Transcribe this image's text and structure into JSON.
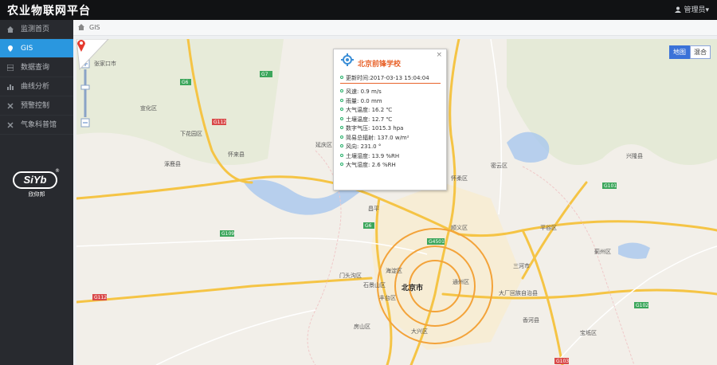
{
  "app": {
    "title": "农业物联网平台"
  },
  "user": {
    "label": "管理员▾"
  },
  "sidebar": {
    "items": [
      {
        "label": "监测首页",
        "active": false,
        "icon": "home-icon"
      },
      {
        "label": "GIS",
        "active": true,
        "icon": "location-icon"
      },
      {
        "label": "数据查询",
        "active": false,
        "icon": "table-icon"
      },
      {
        "label": "曲线分析",
        "active": false,
        "icon": "chart-icon"
      },
      {
        "label": "预警控制",
        "active": false,
        "icon": "alert-icon"
      },
      {
        "label": "气象科普馆",
        "active": false,
        "icon": "weather-icon"
      }
    ],
    "logo": {
      "brand": "SiYb",
      "sub": "欣仰邦",
      "reg": "®"
    }
  },
  "breadcrumb": {
    "current": "GIS"
  },
  "map": {
    "type_buttons": [
      "地图",
      "混合"
    ],
    "selected_type": "地图",
    "labels": [
      "北京市",
      "海淀区",
      "门头沟区",
      "石景山区",
      "丰台区",
      "房山区",
      "大兴区",
      "顺义区",
      "通州区",
      "三河市",
      "怀来县",
      "延庆区",
      "涿鹿县",
      "下花园区",
      "宣化区",
      "张家口市",
      "昌平",
      "平谷区",
      "蓟州区",
      "兴隆县",
      "密云区",
      "大厂回族自治县",
      "香河县",
      "宝坻区",
      "怀柔区"
    ]
  },
  "popup": {
    "title": "北京前锋学校",
    "updated": "更新时间:2017-03-13 15:04:04",
    "readings": [
      "风速: 0.9 m/s",
      "雨量: 0.0 mm",
      "大气温度: 16.2 ℃",
      "土壤温度: 12.7 ℃",
      "数字气压: 1015.3 hpa",
      "简易总辐射: 137.0 w/m²",
      "风向: 231.0 °",
      "土壤湿度: 13.9 %RH",
      "大气湿度: 2.6 %RH"
    ],
    "close": "×"
  },
  "colors": {
    "accent": "#2a97df",
    "popup_title": "#e8632b",
    "topbar": "#111214",
    "sidebar": "#282a2f"
  }
}
